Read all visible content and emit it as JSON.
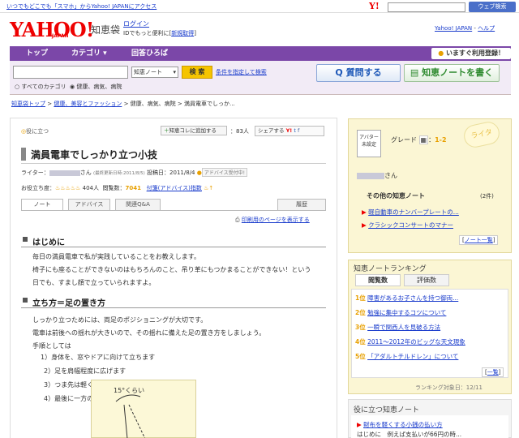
{
  "top_strip": {
    "promo_link": "いつでもどこでも「スマホ」からYahoo! JAPANにアクセス",
    "search_button": "ウェブ検索"
  },
  "header": {
    "logo": "YAHOO!",
    "logo_sub": "JAPAN",
    "service_name": "知恵袋",
    "login": "ログイン",
    "reg_text": "IDでもっと便利に[",
    "reg_link": "新規取得",
    "reg_close": "]",
    "yahoo_japan_link": "Yahoo! JAPAN",
    "help_link": "ヘルプ"
  },
  "nav": {
    "tabs": [
      "トップ",
      "カテゴリ ▾",
      "回答ひろば"
    ],
    "register": "いますぐ利用登録！"
  },
  "search": {
    "select_value": "知恵ノート",
    "button": "検 索",
    "advanced": "条件を指定して検索",
    "radio_all": "すべてのカテゴリ",
    "radio_cat": "健康、病気、病院",
    "ask_button": "質問する",
    "note_button": "知恵ノートを書く"
  },
  "breadcrumb": {
    "top": "知恵袋トップ",
    "cat": "健康、美容とファッション",
    "rest": "> 健康、病気、病院 > 満員電車でしっか..."
  },
  "article": {
    "useful_tag": "役に立つ",
    "add_note": "知恵コレに追加する",
    "add_count": "83人",
    "share": "シェアする",
    "title": "満員電車でしっかり立つ小技",
    "writer_label": "ライター：",
    "writer_suffix": "さん",
    "updated": "(最終更新日時:2011/8/5)",
    "posted": "投稿日：2011/8/4",
    "advice_badge": "アドバイス受付中!",
    "useful_label": "お役立ち度：",
    "useful_flames": "♨♨♨♨♨",
    "useful_count": "404人",
    "pv_label": "閲覧数：",
    "pv": "7041",
    "addendum": "付箋(アドバイス)指数",
    "tabs": [
      "ノート",
      "アドバイス",
      "関連Q&A",
      "履歴"
    ],
    "print_link": "印刷用のページを表示する",
    "section1_title": "はじめに",
    "section1_lines": [
      "毎日の満員電車で私が実践していることをお教えします。",
      "椅子にも座ることができないのはもちろんのこと、吊り革にもつかまることができない！という",
      "日でも、すまし顔で立っていられますよ。"
    ],
    "section2_title": "立ち方＝足の置き方",
    "section2_lines": [
      "しっかり立つためには、両足のポジショニングが大切です。",
      "電車は前後への揺れが大きいので、その揺れに備えた足の置き方をしましょう。",
      "手順としては"
    ],
    "steps": [
      "1）身体を、窓やドアに向けて立ちます",
      "2）足を肩幅程度に広げます",
      "3）つま先は軽く外側へ開きます",
      "4）最後に一方の足を後ろへ少し下げましょう"
    ],
    "diagram_label": "15°くらい"
  },
  "sidebar": {
    "avatar_text": "アバター未設定",
    "grade_label": "グレード",
    "grade_value": "1-2",
    "deco": "ライタ",
    "writer_suffix": "さん",
    "other_notes_title": "その他の知恵ノート",
    "other_notes_count": "(2件)",
    "other_notes": [
      "軽自動車のナンバープレートの...",
      "クラシックコンサートのマナー"
    ],
    "note_list_link": "ノート一覧",
    "ranking_title": "知恵ノートランキング",
    "ranking_tabs": [
      "閲覧数",
      "評価数"
    ],
    "ranking": [
      {
        "n": "1位",
        "t": "障害があるお子さんを持つ御両..."
      },
      {
        "n": "2位",
        "t": "勉強に集中するコツについて"
      },
      {
        "n": "3位",
        "t": "一瞬で関西人を見破る方法"
      },
      {
        "n": "4位",
        "t": "2011〜2012年のビッグな天文現象"
      },
      {
        "n": "5位",
        "t": "「アダルトチルドレン」について"
      }
    ],
    "ranking_more": "一覧",
    "ranking_date": "ランキング対象日：12/11",
    "useful_notes_title": "役に立つ知恵ノート",
    "useful_note_1": "財布を軽くする小銭の払い方",
    "useful_note_2": "はじめに　例えば支払いが66円の時..."
  },
  "colors": {
    "nav_purple": "#7b47a8",
    "link_blue": "#1a3ccc",
    "yahoo_red": "#e00000",
    "side_yellow": "#fbf6d4",
    "accent_orange": "#e8a000"
  }
}
